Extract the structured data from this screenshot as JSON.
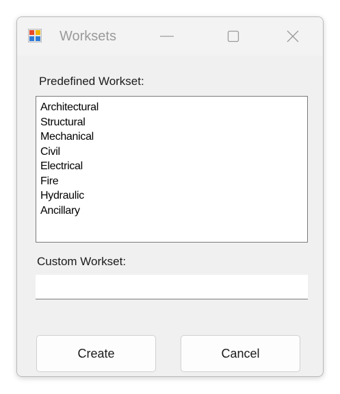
{
  "window": {
    "title": "Worksets",
    "icon": "windows-forms-app-icon"
  },
  "caption_buttons": {
    "minimize_icon": "minimize-icon",
    "maximize_icon": "maximize-icon",
    "close_icon": "close-icon"
  },
  "predefined": {
    "label": "Predefined Workset:",
    "items": [
      "Architectural",
      "Structural",
      "Mechanical",
      "Civil",
      "Electrical",
      "Fire",
      "Hydraulic",
      "Ancillary"
    ]
  },
  "custom": {
    "label": "Custom Workset:",
    "value": ""
  },
  "buttons": {
    "create_label": "Create",
    "cancel_label": "Cancel"
  },
  "colors": {
    "window_bg": "#f0f0f0",
    "title_text": "#9a9a9a",
    "list_border": "#7a7a7a"
  }
}
